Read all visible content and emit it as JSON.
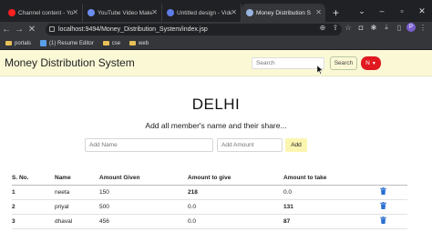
{
  "browser": {
    "tabs": [
      {
        "title": "Channel content - YouTube",
        "color": "#ff2020"
      },
      {
        "title": "YouTube Video Maker | Fr",
        "color": "#6a8df0"
      },
      {
        "title": "Untitled design - Video",
        "color": "#5e7de8"
      },
      {
        "title": "Money Distribution Syste",
        "color": "#9ab4e0"
      }
    ],
    "new_tab": "+",
    "url": "localhost:9494/Money_Distribution_System/index.jsp",
    "profile_initial": "P",
    "bookmarks": [
      "portals",
      "(1) Resume Editor",
      "cse",
      "web"
    ]
  },
  "app": {
    "brand": "Money Distribution System",
    "search_placeholder": "Search",
    "search_button": "Search",
    "user_initial": "N"
  },
  "main": {
    "city": "DELHI",
    "subtitle": "Add all member's name and their share...",
    "name_placeholder": "Add Name",
    "amount_placeholder": "Add Amount",
    "add_button": "Add"
  },
  "table": {
    "headers": [
      "S. No.",
      "Name",
      "Amount Given",
      "Amount to give",
      "Amount to take"
    ],
    "rows": [
      {
        "sno": "1",
        "name": "neeta",
        "given": "150",
        "to_give": "218",
        "to_take": "0.0"
      },
      {
        "sno": "2",
        "name": "priyal",
        "given": "500",
        "to_give": "0.0",
        "to_take": "131"
      },
      {
        "sno": "3",
        "name": "dhaval",
        "given": "456",
        "to_give": "0.0",
        "to_take": "87"
      }
    ]
  }
}
